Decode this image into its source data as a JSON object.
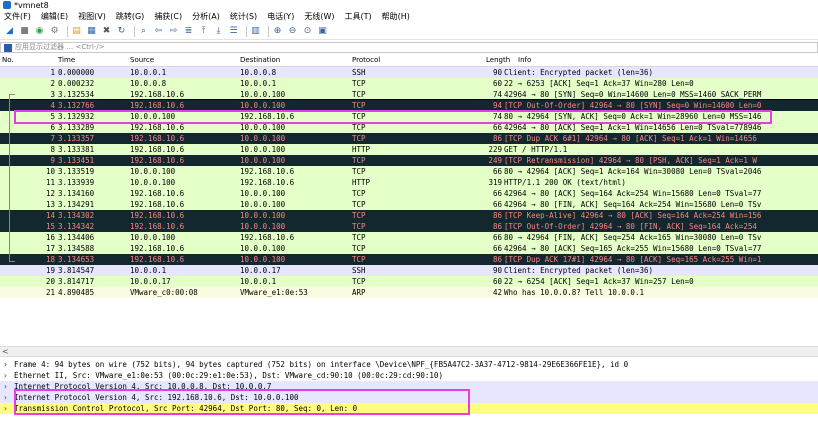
{
  "window": {
    "title": "*vmnet8"
  },
  "menu": [
    "文件(F)",
    "编辑(E)",
    "视图(V)",
    "跳转(G)",
    "捕获(C)",
    "分析(A)",
    "统计(S)",
    "电话(Y)",
    "无线(W)",
    "工具(T)",
    "帮助(H)"
  ],
  "toolbar": [
    "shark-fin-icon",
    "stop-icon",
    "restart-icon",
    "options-icon",
    "open-icon",
    "save-icon",
    "close-icon",
    "reload-icon",
    "find-icon",
    "back-icon",
    "forward-icon",
    "goto-icon",
    "first-icon",
    "last-icon",
    "autoscroll-icon",
    "colorize-icon",
    "zoom-in-icon",
    "zoom-out-icon",
    "zoom-normal-icon",
    "resize-columns-icon"
  ],
  "filter": {
    "placeholder": "应用显示过滤器 … <Ctrl-/>"
  },
  "columns": {
    "no": "No.",
    "time": "Time",
    "source": "Source",
    "destination": "Destination",
    "protocol": "Protocol",
    "length": "Length",
    "info": "Info"
  },
  "colors": {
    "tcp_green": "#e4ffc7",
    "http_green": "#e4ffc7",
    "ssh_lavender": "#e7e6ff",
    "arp_yellow": "#fafbe0",
    "dark_bg": "#12272e",
    "dark_fg": "#f78787",
    "selected": "#12272e",
    "highlight": "#e53ee5",
    "tcp_row_detail": "#ffff80"
  },
  "packets": [
    {
      "no": "1",
      "time": "0.000000",
      "src": "10.0.0.1",
      "dst": "10.0.0.8",
      "proto": "SSH",
      "len": "90",
      "info": "Client: Encrypted packet (len=36)",
      "style": "ssh"
    },
    {
      "no": "2",
      "time": "0.000232",
      "src": "10.0.0.8",
      "dst": "10.0.0.1",
      "proto": "TCP",
      "len": "60",
      "info": "22 → 6253 [ACK] Seq=1 Ack=37 Win=280 Len=0",
      "style": "tcp"
    },
    {
      "no": "3",
      "time": "3.132534",
      "src": "192.168.10.6",
      "dst": "10.0.0.100",
      "proto": "TCP",
      "len": "74",
      "info": "42964 → 80 [SYN] Seq=0 Win=14600 Len=0 MSS=1460 SACK_PERM",
      "style": "tcp"
    },
    {
      "no": "4",
      "time": "3.132766",
      "src": "192.168.10.6",
      "dst": "10.0.0.100",
      "proto": "TCP",
      "len": "94",
      "info": "[TCP Out-Of-Order] 42964 → 80 [SYN] Seq=0 Win=14600 Len=0",
      "style": "dark"
    },
    {
      "no": "5",
      "time": "3.132932",
      "src": "10.0.0.100",
      "dst": "192.168.10.6",
      "proto": "TCP",
      "len": "74",
      "info": "80 → 42964 [SYN, ACK] Seq=0 Ack=1 Win=28960 Len=0 MSS=146",
      "style": "tcp"
    },
    {
      "no": "6",
      "time": "3.133289",
      "src": "192.168.10.6",
      "dst": "10.0.0.100",
      "proto": "TCP",
      "len": "66",
      "info": "42964 → 80 [ACK] Seq=1 Ack=1 Win=14656 Len=0 TSval=778946",
      "style": "tcp"
    },
    {
      "no": "7",
      "time": "3.133357",
      "src": "192.168.10.6",
      "dst": "10.0.0.100",
      "proto": "TCP",
      "len": "86",
      "info": "[TCP Dup ACK 6#1] 42964 → 80 [ACK] Seq=1 Ack=1 Win=14656",
      "style": "dark"
    },
    {
      "no": "8",
      "time": "3.133381",
      "src": "192.168.10.6",
      "dst": "10.0.0.100",
      "proto": "HTTP",
      "len": "229",
      "info": "GET / HTTP/1.1",
      "style": "tcp"
    },
    {
      "no": "9",
      "time": "3.133451",
      "src": "192.168.10.6",
      "dst": "10.0.0.100",
      "proto": "TCP",
      "len": "249",
      "info": "[TCP Retransmission] 42964 → 80 [PSH, ACK] Seq=1 Ack=1 W",
      "style": "dark"
    },
    {
      "no": "10",
      "time": "3.133519",
      "src": "10.0.0.100",
      "dst": "192.168.10.6",
      "proto": "TCP",
      "len": "66",
      "info": "80 → 42964 [ACK] Seq=1 Ack=164 Win=30080 Len=0 TSval=2046",
      "style": "tcp"
    },
    {
      "no": "11",
      "time": "3.133939",
      "src": "10.0.0.100",
      "dst": "192.168.10.6",
      "proto": "HTTP",
      "len": "319",
      "info": "HTTP/1.1 200 OK  (text/html)",
      "style": "tcp"
    },
    {
      "no": "12",
      "time": "3.134160",
      "src": "192.168.10.6",
      "dst": "10.0.0.100",
      "proto": "TCP",
      "len": "66",
      "info": "42964 → 80 [ACK] Seq=164 Ack=254 Win=15680 Len=0 TSval=77",
      "style": "tcp"
    },
    {
      "no": "13",
      "time": "3.134291",
      "src": "192.168.10.6",
      "dst": "10.0.0.100",
      "proto": "TCP",
      "len": "66",
      "info": "42964 → 80 [FIN, ACK] Seq=164 Ack=254 Win=15680 Len=0 TSv",
      "style": "tcp"
    },
    {
      "no": "14",
      "time": "3.134302",
      "src": "192.168.10.6",
      "dst": "10.0.0.100",
      "proto": "TCP",
      "len": "86",
      "info": "[TCP Keep-Alive] 42964 → 80 [ACK] Seq=164 Ack=254 Win=156",
      "style": "dark"
    },
    {
      "no": "15",
      "time": "3.134342",
      "src": "192.168.10.6",
      "dst": "10.0.0.100",
      "proto": "TCP",
      "len": "86",
      "info": "[TCP Out-Of-Order] 42964 → 80 [FIN, ACK] Seq=164 Ack=254",
      "style": "dark"
    },
    {
      "no": "16",
      "time": "3.134406",
      "src": "10.0.0.100",
      "dst": "192.168.10.6",
      "proto": "TCP",
      "len": "66",
      "info": "80 → 42964 [FIN, ACK] Seq=254 Ack=165 Win=30080 Len=0 TSv",
      "style": "tcp"
    },
    {
      "no": "17",
      "time": "3.134588",
      "src": "192.168.10.6",
      "dst": "10.0.0.100",
      "proto": "TCP",
      "len": "66",
      "info": "42964 → 80 [ACK] Seq=165 Ack=255 Win=15680 Len=0 TSval=77",
      "style": "tcp"
    },
    {
      "no": "18",
      "time": "3.134653",
      "src": "192.168.10.6",
      "dst": "10.0.0.100",
      "proto": "TCP",
      "len": "86",
      "info": "[TCP Dup ACK 17#1] 42964 → 80 [ACK] Seq=165 Ack=255 Win=1",
      "style": "dark"
    },
    {
      "no": "19",
      "time": "3.814547",
      "src": "10.0.0.1",
      "dst": "10.0.0.17",
      "proto": "SSH",
      "len": "90",
      "info": "Client: Encrypted packet (len=36)",
      "style": "ssh"
    },
    {
      "no": "20",
      "time": "3.814717",
      "src": "10.0.0.17",
      "dst": "10.0.0.1",
      "proto": "TCP",
      "len": "60",
      "info": "22 → 6254 [ACK] Seq=1 Ack=37 Win=257 Len=0",
      "style": "tcp"
    },
    {
      "no": "21",
      "time": "4.890485",
      "src": "VMware_c0:00:08",
      "dst": "VMware_e1:0e:53",
      "proto": "ARP",
      "len": "42",
      "info": "Who has 10.0.0.8? Tell 10.0.0.1",
      "style": "arp"
    }
  ],
  "detail": [
    {
      "text": "Frame 4: 94 bytes on wire (752 bits), 94 bytes captured (752 bits) on interface \\Device\\NPF_{FB5A47C2-3A37-4712-9814-29E6E366FE1E}, id 0",
      "style": "plain"
    },
    {
      "text": "Ethernet II, Src: VMware_e1:0e:53 (00:0c:29:e1:0e:53), Dst: VMware_cd:90:10 (00:0c:29:cd:90:10)",
      "style": "plain"
    },
    {
      "text": "Internet Protocol Version 4, Src: 10.0.0.8, Dst: 10.0.0.7",
      "style": "ip"
    },
    {
      "text": "Internet Protocol Version 4, Src: 192.168.10.6, Dst: 10.0.0.100",
      "style": "ip"
    },
    {
      "text": "Transmission Control Protocol, Src Port: 42964, Dst Port: 80, Seq: 0, Len: 0",
      "style": "tcp"
    }
  ]
}
